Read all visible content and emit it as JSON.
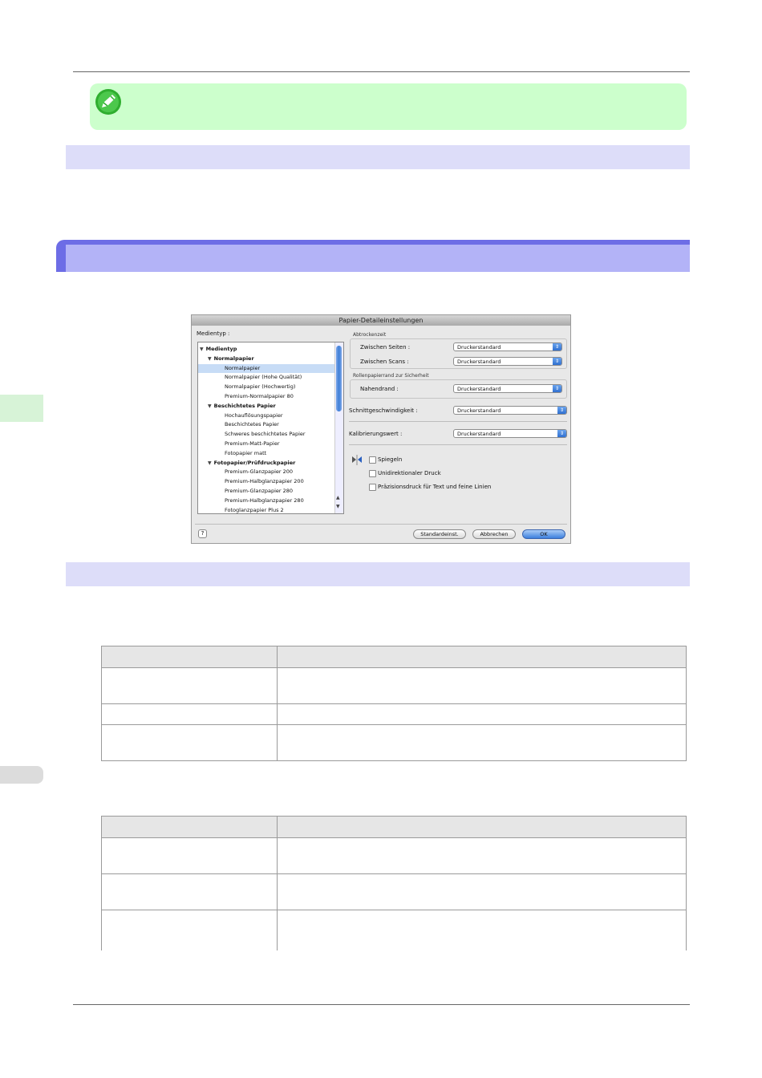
{
  "dialog": {
    "title": "Papier-Detaileinstellungen",
    "media_type_label": "Medientyp :",
    "media_list": [
      {
        "label": "Medientyp",
        "level": 0,
        "bold": true,
        "expanded": true
      },
      {
        "label": "Normalpapier",
        "level": 1,
        "bold": true,
        "expanded": true
      },
      {
        "label": "Normalpapier",
        "level": 2,
        "selected": true
      },
      {
        "label": "Normalpapier (Hohe Qualität)",
        "level": 2
      },
      {
        "label": "Normalpapier (Hochwertig)",
        "level": 2
      },
      {
        "label": "Premium-Normalpapier 80",
        "level": 2
      },
      {
        "label": "Beschichtetes Papier",
        "level": 1,
        "bold": true,
        "expanded": true
      },
      {
        "label": "Hochauflösungspapier",
        "level": 2
      },
      {
        "label": "Beschichtetes Papier",
        "level": 2
      },
      {
        "label": "Schweres beschichtetes Papier",
        "level": 2
      },
      {
        "label": "Premium-Matt-Papier",
        "level": 2
      },
      {
        "label": "Fotopapier matt",
        "level": 2
      },
      {
        "label": "Fotopapier/Prüfdruckpapier",
        "level": 1,
        "bold": true,
        "expanded": true
      },
      {
        "label": "Premium-Glanzpapier 200",
        "level": 2
      },
      {
        "label": "Premium-Halbglanzpapier 200",
        "level": 2
      },
      {
        "label": "Premium-Glanzpapier 280",
        "level": 2
      },
      {
        "label": "Premium-Halbglanzpapier 280",
        "level": 2
      },
      {
        "label": "Fotoglanzpapier Plus 2",
        "level": 2
      }
    ],
    "drying_time": {
      "group_label": "Abtrockenzeit",
      "between_pages_label": "Zwischen Seiten :",
      "between_pages_value": "Druckerstandard",
      "between_scans_label": "Zwischen Scans :",
      "between_scans_value": "Druckerstandard"
    },
    "roll_margin": {
      "group_label": "Rollenpapierrand zur Sicherheit",
      "near_edge_label": "Nahendrand :",
      "near_edge_value": "Druckerstandard"
    },
    "cut_speed_label": "Schnittgeschwindigkeit :",
    "cut_speed_value": "Druckerstandard",
    "calibration_label": "Kalibrierungswert :",
    "calibration_value": "Druckerstandard",
    "options": [
      {
        "label": "Spiegeln",
        "checked": false
      },
      {
        "label": "Unidirektionaler Druck",
        "checked": false
      },
      {
        "label": "Präzisionsdruck für Text und feine Linien",
        "checked": false
      }
    ],
    "buttons": {
      "defaults": "Standardeinst.",
      "cancel": "Abbrechen",
      "ok": "OK",
      "help": "?"
    }
  },
  "colors": {
    "note_bg": "#ccffcc",
    "section_band": "#ddddf9",
    "heading_accent": "#6d6de6",
    "heading_fill": "#b3b3f7"
  }
}
